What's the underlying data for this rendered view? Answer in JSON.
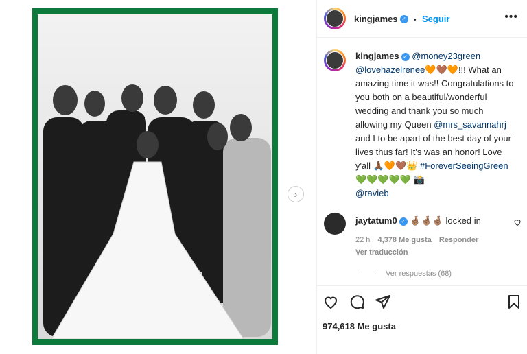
{
  "post": {
    "author": "kingjames",
    "follow_label": "Seguir",
    "dot": "•",
    "more_label": "•••"
  },
  "caption": {
    "author": "kingjames",
    "mention1": "@money23green",
    "mention2": "@lovehazelrenee",
    "hearts1": "🧡🤎🧡",
    "text1": "!!! What an amazing time it was!! Congratulations to you both on a beautiful/wonderful wedding and thank you so much allowing my Queen ",
    "mention3": "@mrs_savannahrj",
    "text2": " and I to be apart of the best day of your lives thus far! It's was an honor! Love y'all ",
    "emoji2": "🙏🏾🧡🤎👑",
    "hashtag": "#ForeverSeeingGreen",
    "hearts2": " 💚💚💚💚💚 📸",
    "mention4": "@ravieb"
  },
  "comment": {
    "author": "jaytatum0",
    "emoji": "🤞🏽🤞🏽🤞🏽",
    "text": "locked in",
    "time": "22 h",
    "likes": "4,378 Me gusta",
    "reply": "Responder",
    "translate": "Ver traducción"
  },
  "replies_label": "Ver respuestas (68)",
  "likes_label": "974,618 Me gusta",
  "colors": {
    "frame": "#0b7a3a",
    "accent": "#0095f6"
  },
  "icons": [
    "heart-icon",
    "comment-icon",
    "share-icon",
    "bookmark-icon",
    "chevron-right-icon",
    "verified-icon"
  ]
}
